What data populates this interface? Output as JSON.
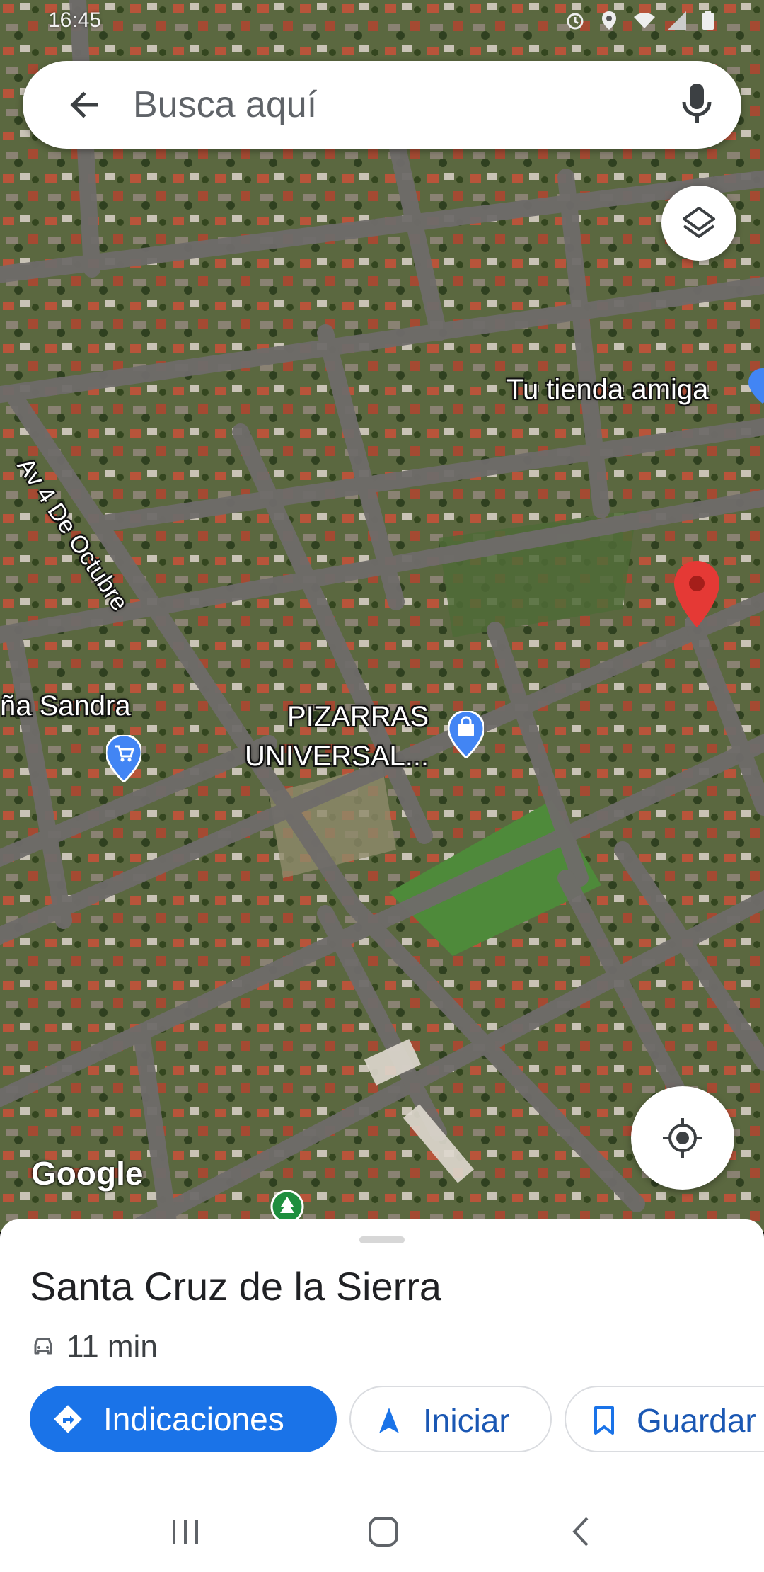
{
  "status_bar": {
    "time": "16:45"
  },
  "search": {
    "placeholder": "Busca aquí"
  },
  "map": {
    "labels": {
      "street": "Av 4 De Octubre",
      "store_1": "Tu tienda amiga",
      "store_2": "ña Sandra",
      "business_line1": "PIZARRAS",
      "business_line2": "UNIVERSAL..."
    },
    "logo": "Google"
  },
  "place": {
    "title": "Santa Cruz de la Sierra",
    "drive_time": "11 min"
  },
  "actions": {
    "directions": "Indicaciones",
    "start": "Iniciar",
    "save": "Guardar"
  },
  "colors": {
    "accent": "#1a73e8",
    "pin": "#e53935"
  }
}
